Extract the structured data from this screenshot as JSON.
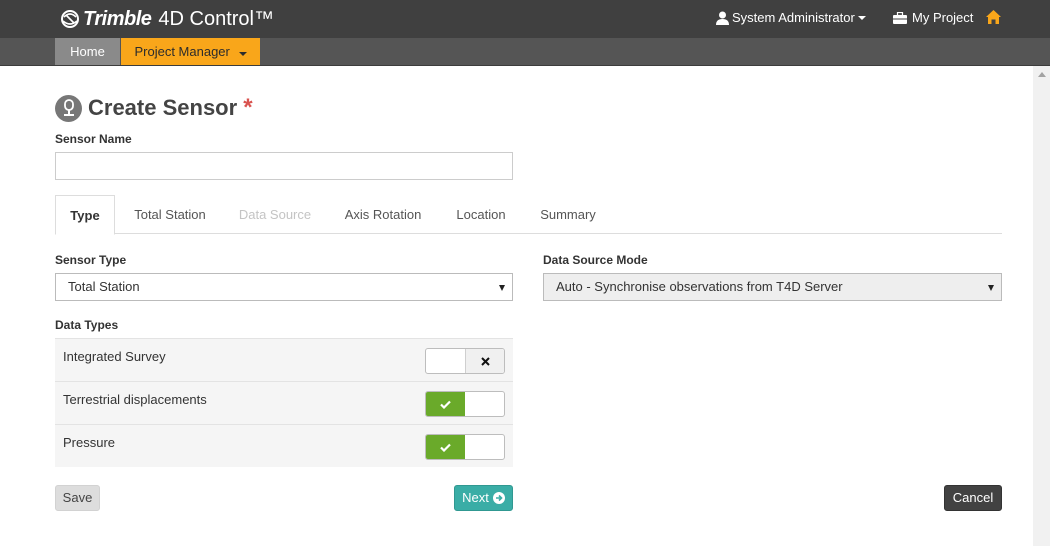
{
  "app": {
    "brand": "Trimble",
    "product": "4D Control™"
  },
  "header": {
    "user_label": "System Administrator",
    "project_label": "My Project"
  },
  "nav": {
    "home_label": "Home",
    "project_manager_label": "Project Manager"
  },
  "page": {
    "title": "Create Sensor",
    "required_marker": "*"
  },
  "form": {
    "sensor_name_label": "Sensor Name",
    "sensor_name_value": "",
    "sensor_name_placeholder": "",
    "sensor_type_label": "Sensor Type",
    "sensor_type_value": "Total Station",
    "data_source_mode_label": "Data Source Mode",
    "data_source_mode_value": "Auto - Synchronise observations from T4D Server",
    "data_types_label": "Data Types"
  },
  "tabs": [
    {
      "label": "Type"
    },
    {
      "label": "Total Station"
    },
    {
      "label": "Data Source"
    },
    {
      "label": "Axis Rotation"
    },
    {
      "label": "Location"
    },
    {
      "label": "Summary"
    }
  ],
  "data_types": [
    {
      "label": "Integrated Survey",
      "enabled": false
    },
    {
      "label": "Terrestrial displacements",
      "enabled": true
    },
    {
      "label": "Pressure",
      "enabled": true
    }
  ],
  "buttons": {
    "save_label": "Save",
    "next_label": "Next",
    "cancel_label": "Cancel"
  },
  "colors": {
    "accent": "#f9a61a",
    "toggle_on": "#6aaa2a",
    "next": "#3aada6",
    "required": "#d9534f"
  },
  "icons": {
    "user": "user-icon",
    "project": "briefcase-icon",
    "home": "home-icon",
    "sensor": "sensor-icon",
    "check": "check-icon",
    "cross": "cross-icon",
    "next": "arrow-circle-right-icon"
  }
}
